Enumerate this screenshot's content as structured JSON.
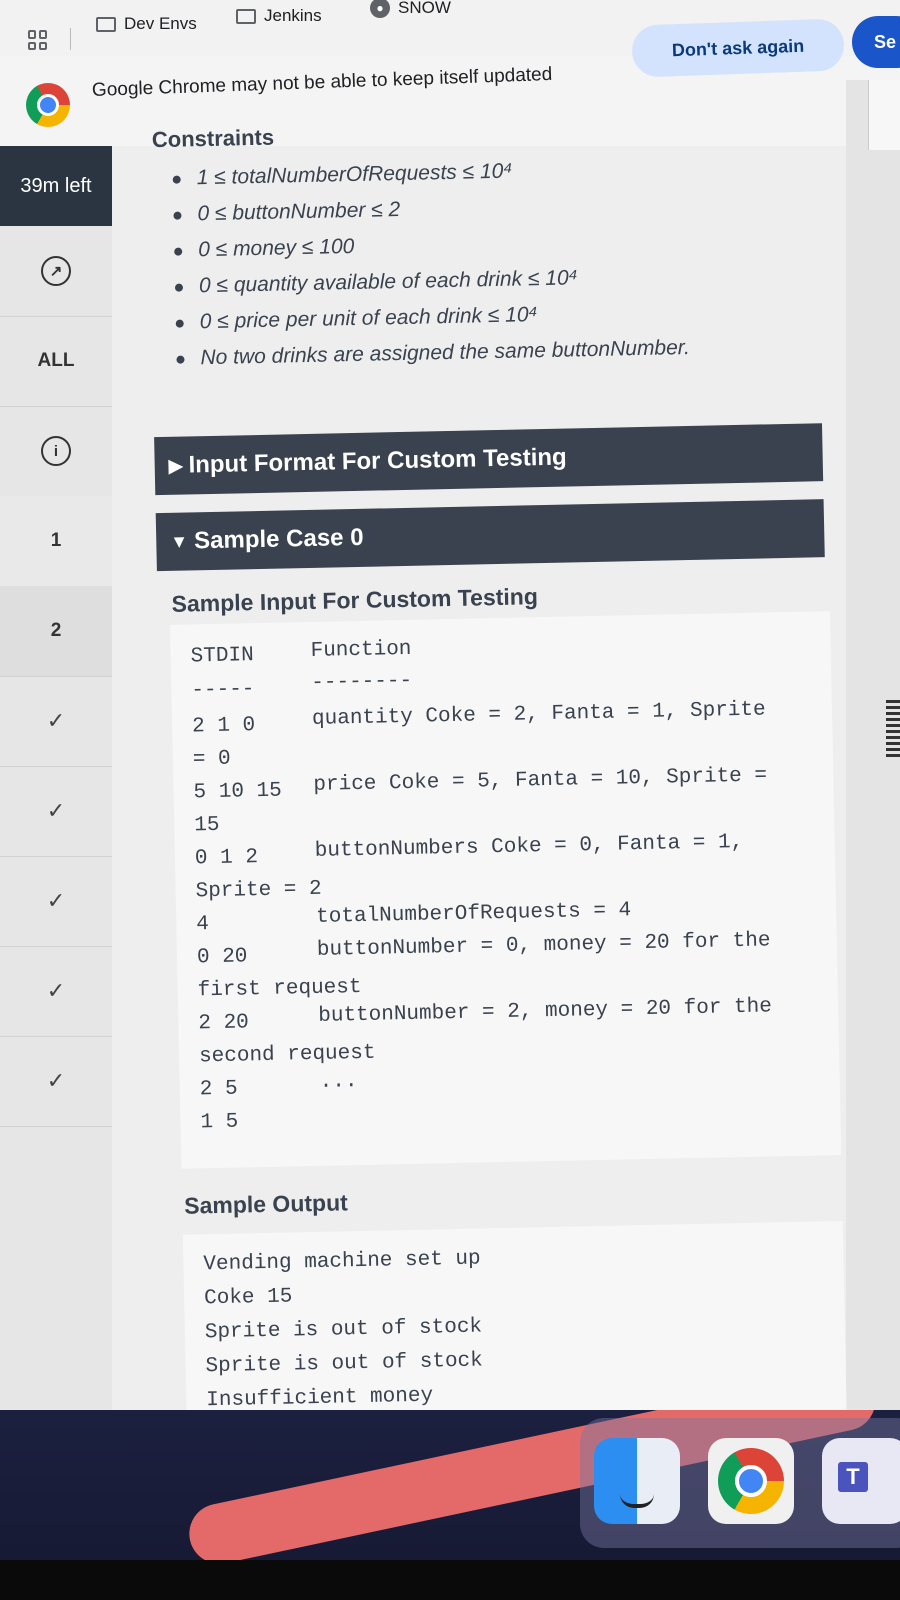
{
  "bookmarks": {
    "items": [
      {
        "label": "Dev Envs",
        "icon": "folder-icon"
      },
      {
        "label": "Jenkins",
        "icon": "folder-icon"
      },
      {
        "label": "SNOW",
        "icon": "snow-icon"
      }
    ]
  },
  "infobar": {
    "message": "Google Chrome may not be able to keep itself updated",
    "dont_ask_label": "Don't ask again",
    "second_button_label": "Se"
  },
  "sidebar": {
    "timer": "39m left",
    "all_label": "ALL",
    "questions": [
      "1",
      "2"
    ]
  },
  "constraints": {
    "title": "Constraints",
    "items": [
      "1 ≤ totalNumberOfRequests ≤ 10⁴",
      "0 ≤ buttonNumber ≤ 2",
      "0 ≤ money ≤ 100",
      "0 ≤ quantity available of each drink ≤ 10⁴",
      "0 ≤ price per unit of each drink ≤ 10⁴",
      "No two drinks are assigned the same buttonNumber."
    ]
  },
  "sections": {
    "input_format": "Input Format For Custom Testing",
    "sample_case": "Sample Case 0",
    "sample_input_title": "Sample Input For Custom Testing",
    "sample_output_title": "Sample Output"
  },
  "sample_input": {
    "header_stdin": "STDIN",
    "header_function": "Function",
    "rule_stdin": "-----",
    "rule_function": "--------",
    "rows": [
      {
        "stdin": "2 1 0",
        "function": "quantity Coke = 2, Fanta = 1, Sprite",
        "wrap": "= 0"
      },
      {
        "stdin": "5 10 15",
        "function": "price Coke = 5, Fanta = 10, Sprite =",
        "wrap": "15"
      },
      {
        "stdin": "0 1 2",
        "function": "buttonNumbers Coke = 0, Fanta = 1,",
        "wrap": "Sprite = 2"
      },
      {
        "stdin": "4",
        "function": "totalNumberOfRequests = 4",
        "wrap": ""
      },
      {
        "stdin": "0 20",
        "function": "buttonNumber = 0, money = 20 for the",
        "wrap": "first request"
      },
      {
        "stdin": "2 20",
        "function": "buttonNumber = 2, money = 20 for the",
        "wrap": "second request"
      },
      {
        "stdin": "2 5",
        "function": "...",
        "wrap": ""
      },
      {
        "stdin": "1 5",
        "function": "",
        "wrap": ""
      }
    ]
  },
  "sample_output": {
    "lines": [
      "Vending machine set up",
      "Coke 15",
      "Sprite is out of stock",
      "Sprite is out of stock",
      "Insufficient money"
    ]
  },
  "dock": {
    "apps": [
      "finder-icon",
      "chrome-icon",
      "teams-icon"
    ],
    "teams_letter": "T"
  }
}
